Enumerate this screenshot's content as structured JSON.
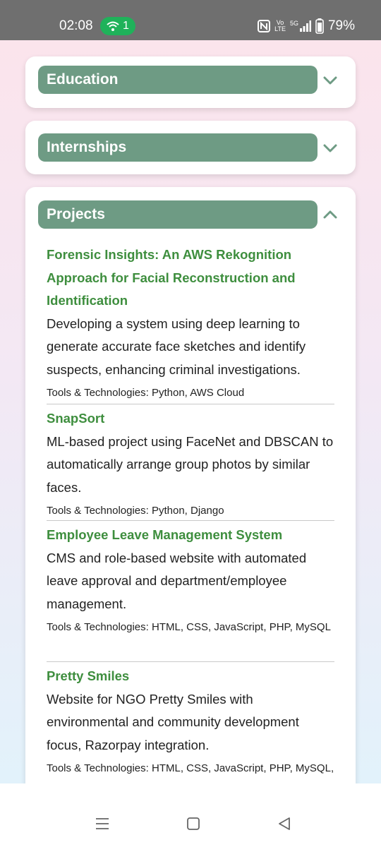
{
  "status_bar": {
    "time": "02:08",
    "hotspot_count": "1",
    "volte_top": "Vo",
    "volte_bottom": "LTE",
    "network": "5G",
    "battery": "79%"
  },
  "sections": {
    "education": {
      "title": "Education",
      "state": "collapsed"
    },
    "internships": {
      "title": "Internships",
      "state": "collapsed"
    },
    "projects": {
      "title": "Projects",
      "state": "expanded"
    }
  },
  "projects": [
    {
      "title": "Forensic Insights: An AWS Rekognition Approach for Facial Reconstruction and Identification",
      "description": "Developing a system using deep learning to generate accurate face sketches and identify suspects, enhancing criminal investigations.",
      "tools": "Tools & Technologies: Python, AWS Cloud"
    },
    {
      "title": "SnapSort",
      "description": "ML-based project using FaceNet and DBSCAN to automatically arrange group photos by similar faces.",
      "tools": "Tools & Technologies: Python, Django"
    },
    {
      "title": "Employee Leave Management System",
      "description": "CMS and role-based website with automated leave approval and department/employee management.",
      "tools": "Tools & Technologies: HTML, CSS, JavaScript, PHP, MySQL"
    },
    {
      "title": "Pretty Smiles",
      "description": "Website for NGO Pretty Smiles with environmental and community development focus, Razorpay integration.",
      "tools": "Tools & Technologies: HTML, CSS, JavaScript, PHP, MySQL, RazorPay"
    }
  ],
  "colors": {
    "accent_green": "#6e9b84",
    "title_green": "#3e8e3e"
  }
}
